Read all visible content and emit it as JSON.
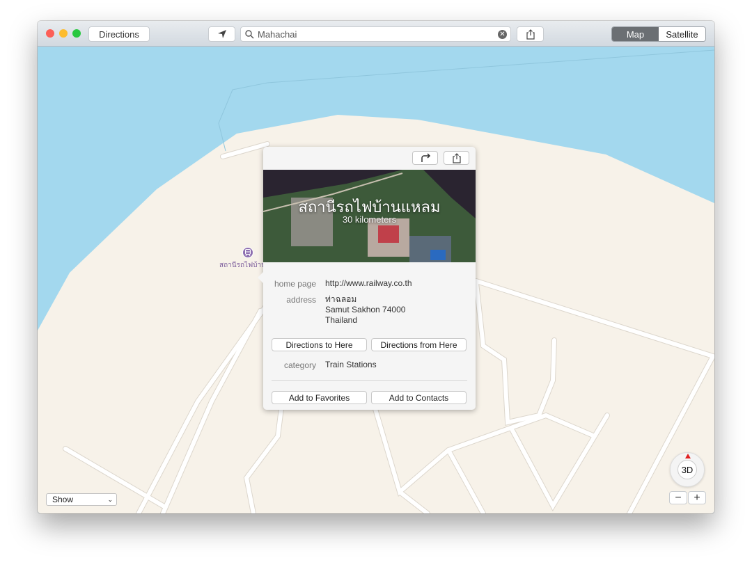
{
  "window": {
    "directions_label": "Directions",
    "search_value": "Mahachai",
    "map_tab": "Map",
    "satellite_tab": "Satellite",
    "active_tab": "Map"
  },
  "map": {
    "pin_label": "สถานีรถไฟบ้านแ",
    "show_label": "Show",
    "compass_label": "3D",
    "zoom_out": "−",
    "zoom_in": "+",
    "colors": {
      "water": "#a3d8ee",
      "land": "#f7f2e9",
      "pin": "#8e6fb0"
    }
  },
  "popover": {
    "title": "สถานีรถไฟบ้านแหลม",
    "distance": "30 kilometers",
    "home_page_label": "home page",
    "home_page": "http://www.railway.co.th",
    "address_label": "address",
    "address_lines": [
      "ท่าฉลอม",
      "Samut Sakhon 74000",
      "Thailand"
    ],
    "directions_to": "Directions to Here",
    "directions_from": "Directions from Here",
    "category_label": "category",
    "category": "Train Stations",
    "add_favorites": "Add to Favorites",
    "add_contacts": "Add to Contacts"
  }
}
